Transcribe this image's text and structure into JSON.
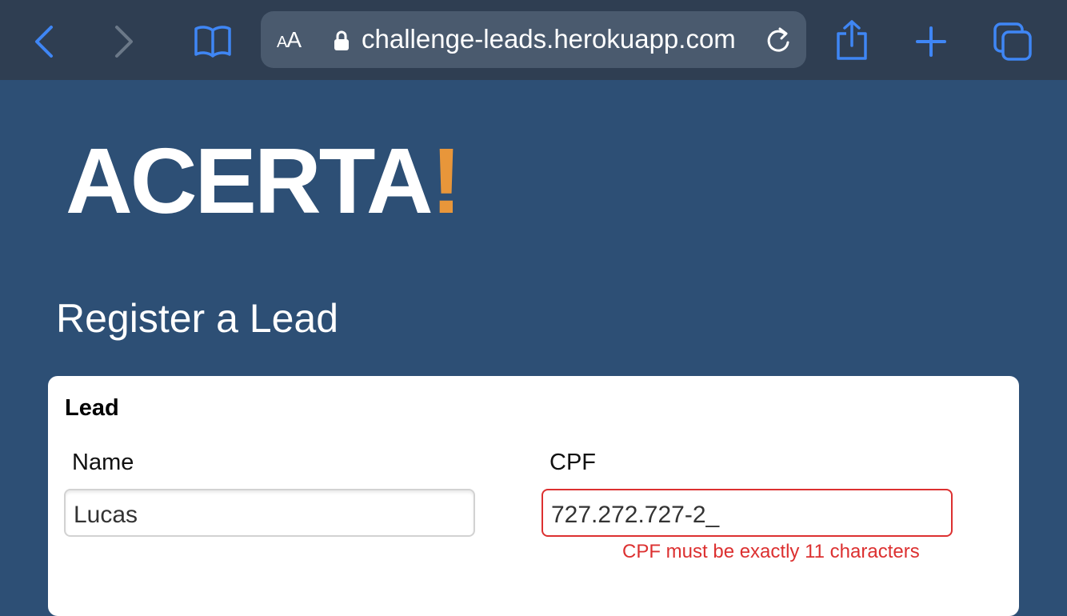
{
  "browser": {
    "text_size_label_small": "A",
    "text_size_label_large": "A",
    "url": "challenge-leads.herokuapp.com"
  },
  "brand": {
    "logo_text": "ACERTA",
    "logo_mark": "!",
    "accent_color": "#e8963a",
    "background_color": "#2d4f75"
  },
  "page": {
    "title": "Register a Lead"
  },
  "form": {
    "section_title": "Lead",
    "name": {
      "label": "Name",
      "value": "Lucas"
    },
    "cpf": {
      "label": "CPF",
      "value": "727.272.727-2_",
      "error": "CPF must be exactly 11 characters",
      "error_color": "#dc3030"
    }
  }
}
